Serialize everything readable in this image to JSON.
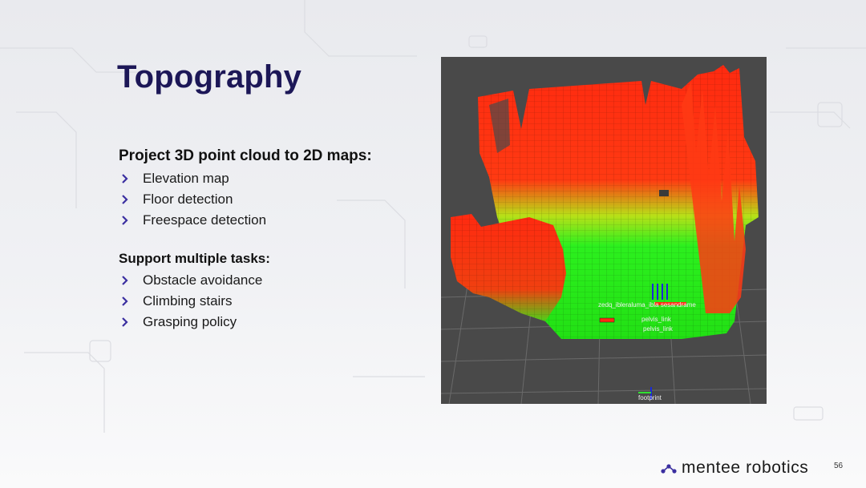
{
  "slide": {
    "title": "Topography",
    "section1": {
      "heading": "Project 3D point cloud to 2D maps:",
      "items": [
        "Elevation map",
        "Floor detection",
        "Freespace detection"
      ]
    },
    "section2": {
      "heading": "Support multiple tasks:",
      "items": [
        "Obstacle avoidance",
        "Climbing stairs",
        "Grasping policy"
      ]
    },
    "map": {
      "frame_labels": [
        "pelvis_link",
        "pelvis_link",
        "footprint"
      ]
    },
    "brand": {
      "name": "mentee robotics"
    },
    "page_number": "56",
    "colors": {
      "title": "#1c1757",
      "bullet": "#3b2fa0",
      "elevation_high": "#ff2a10",
      "elevation_low": "#2cf01e",
      "panel_bg": "#494949"
    },
    "icons": {
      "bullet": "chevron-right-icon",
      "logo": "mentee-logo-icon"
    }
  }
}
